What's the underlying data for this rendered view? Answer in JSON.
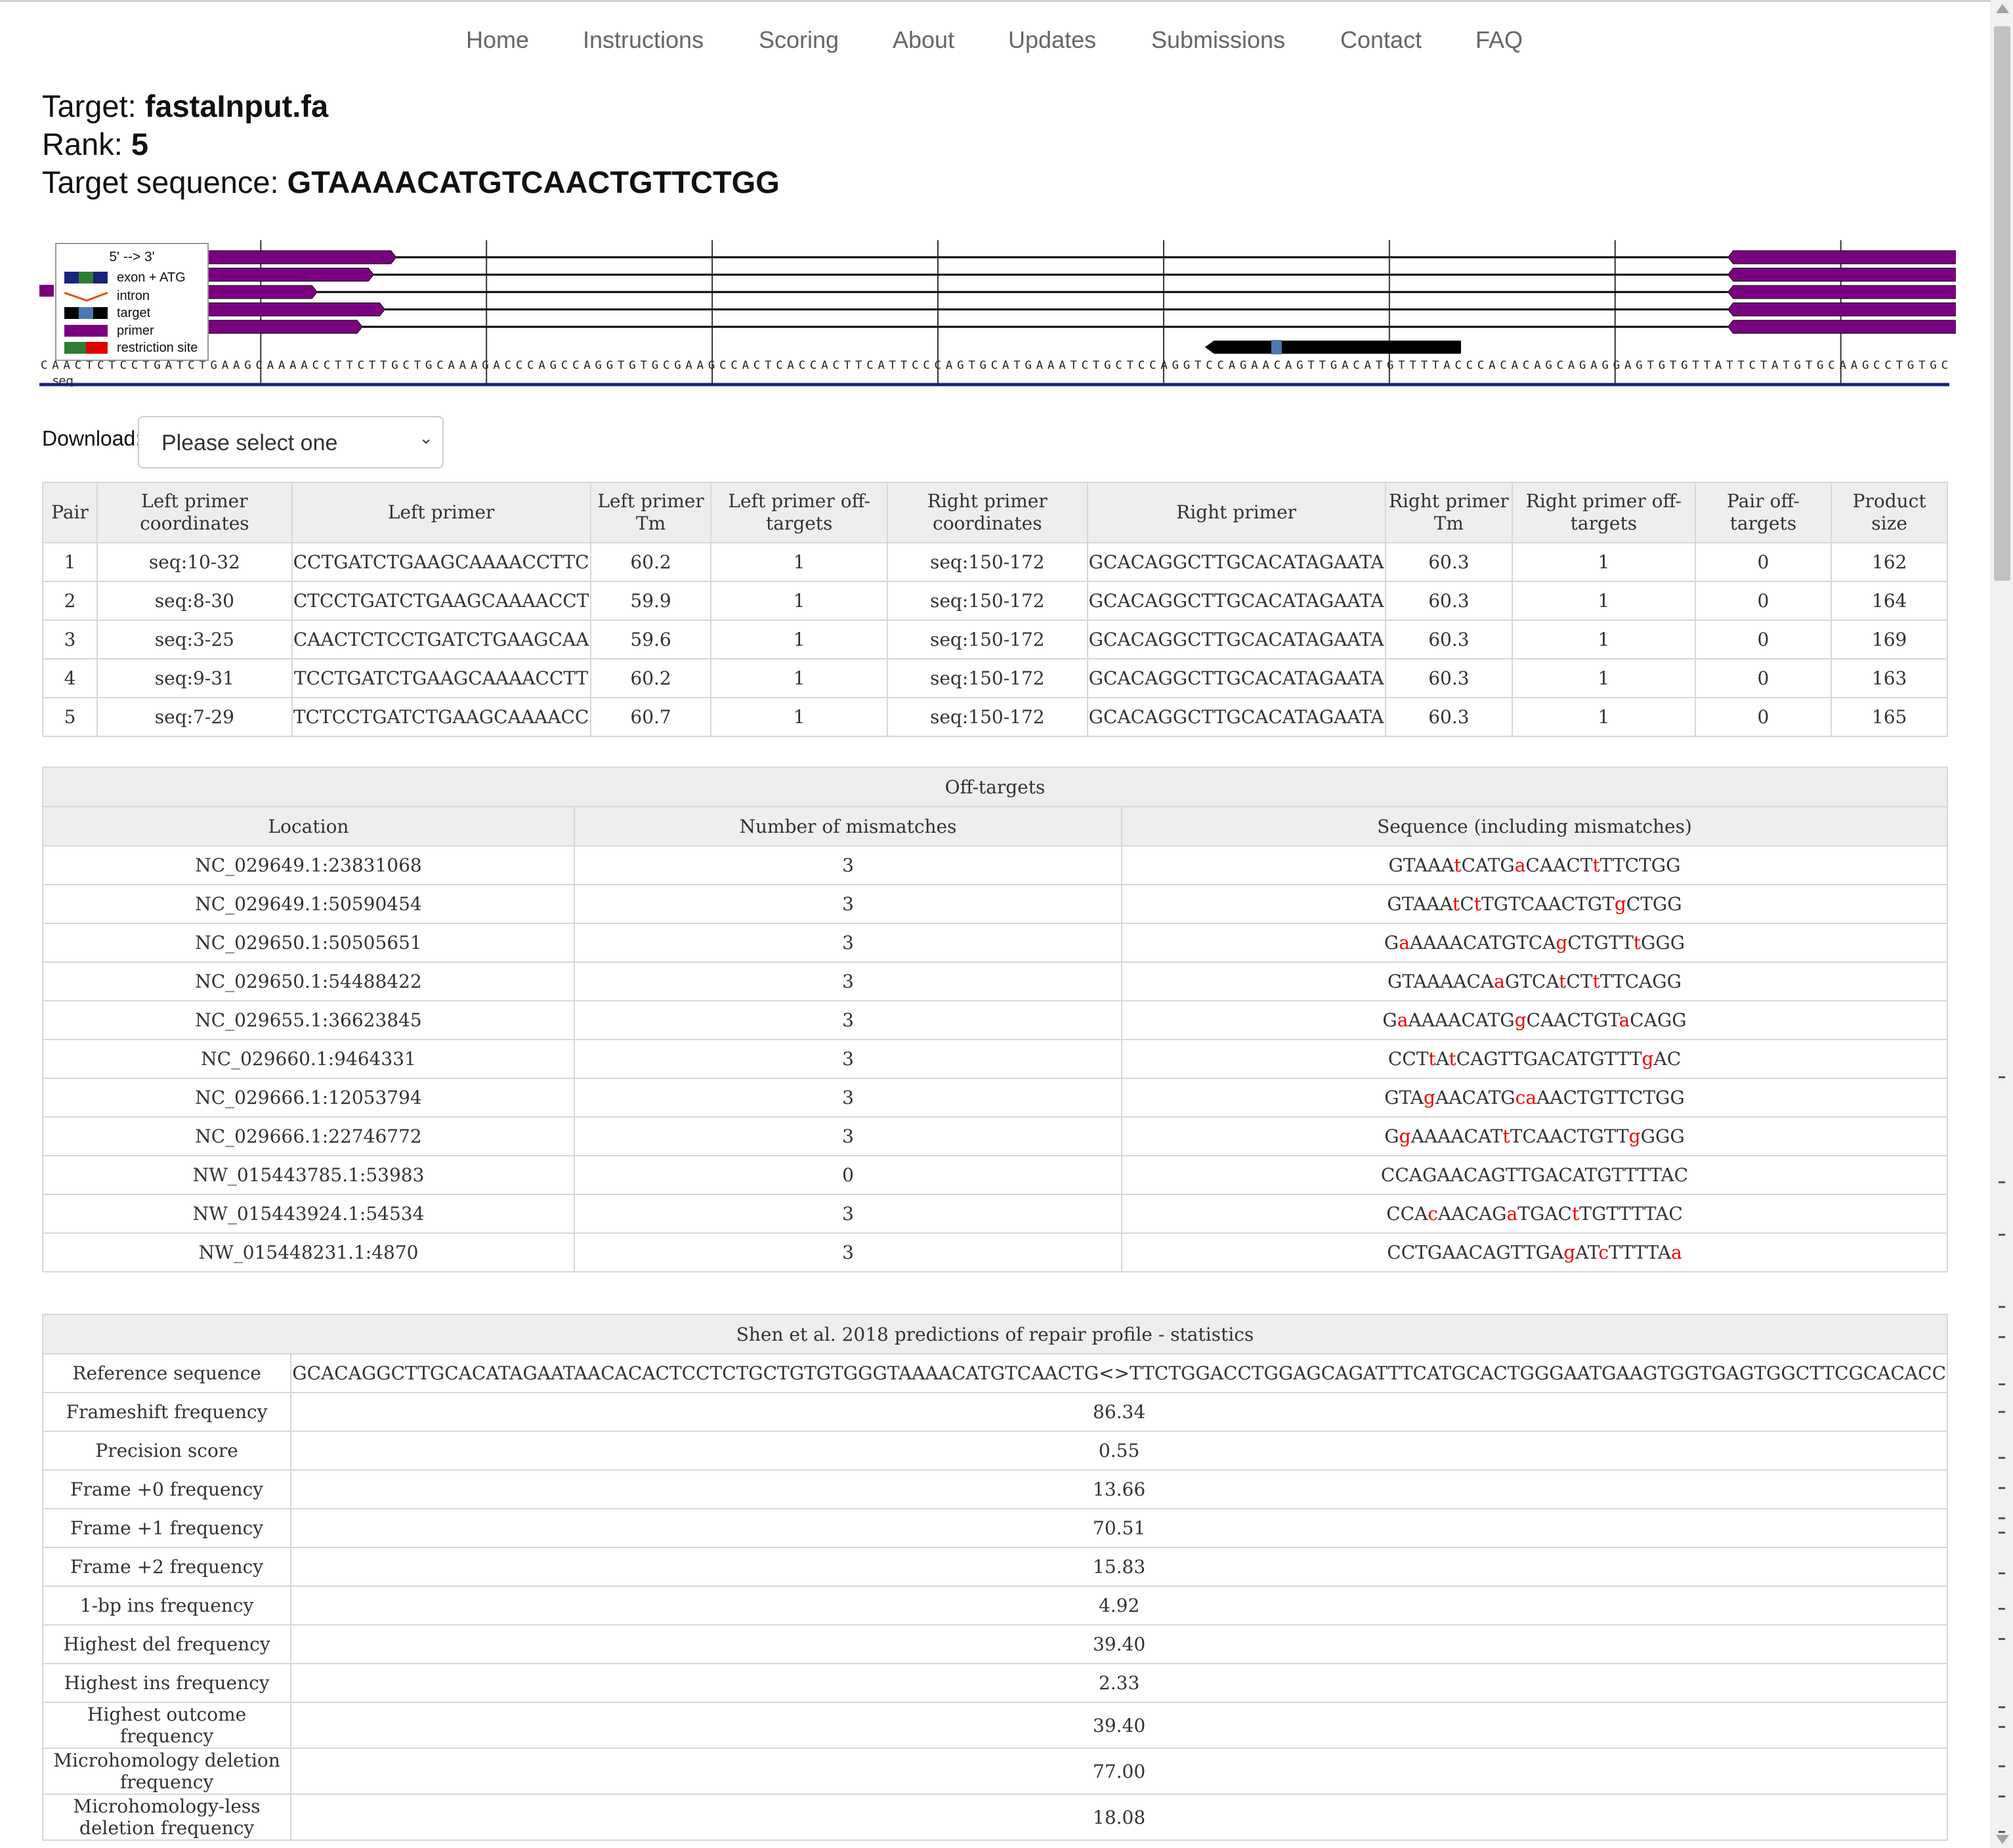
{
  "nav": [
    "Home",
    "Instructions",
    "Scoring",
    "About",
    "Updates",
    "Submissions",
    "Contact",
    "FAQ"
  ],
  "header": {
    "target_label": "Target: ",
    "target": "fastaInput.fa",
    "rank_label": "Rank: ",
    "rank": "5",
    "seq_label": "Target sequence: ",
    "seq": "GTAAAACATGTCAACTGTTCTGG"
  },
  "diagram": {
    "sequence": "CAACTCTCCTGATCTGAAGCAAAACCTTCTTGCTGCAAAGACCCAGCCAGGTGTGCGAAGCCACTCACCACTTCATTCCCAGTGCATGAAATCTGCTCCAGGTCCAGAACAGTTGACATGTTTTACCCACACAGCAGAGGAGTGTGTTATTCTATGTGCAAGCCTGTGC",
    "seq_name": "seq",
    "axis_ticks": [
      "20",
      "40",
      "60",
      "80",
      "100",
      "120",
      "140",
      "160"
    ],
    "legend": {
      "title": "5' --> 3'",
      "items": [
        "exon + ATG",
        "intron",
        "target",
        "primer",
        "restriction site"
      ]
    },
    "colors": {
      "primer": "#7a0080",
      "target": "#000000",
      "target_pam": "#4a7ab0",
      "axis": "#1a237e"
    }
  },
  "download": {
    "label": "Download:",
    "placeholder": "Please select one"
  },
  "pairs_table": {
    "headers": [
      "Pair",
      "Left primer coordinates",
      "Left primer",
      "Left primer Tm",
      "Left primer off-targets",
      "Right primer coordinates",
      "Right primer",
      "Right primer Tm",
      "Right primer off-targets",
      "Pair off-targets",
      "Product size"
    ],
    "rows": [
      [
        "1",
        "seq:10-32",
        "CCTGATCTGAAGCAAAACCTTC",
        "60.2",
        "1",
        "seq:150-172",
        "GCACAGGCTTGCACATAGAATA",
        "60.3",
        "1",
        "0",
        "162"
      ],
      [
        "2",
        "seq:8-30",
        "CTCCTGATCTGAAGCAAAACCT",
        "59.9",
        "1",
        "seq:150-172",
        "GCACAGGCTTGCACATAGAATA",
        "60.3",
        "1",
        "0",
        "164"
      ],
      [
        "3",
        "seq:3-25",
        "CAACTCTCCTGATCTGAAGCAA",
        "59.6",
        "1",
        "seq:150-172",
        "GCACAGGCTTGCACATAGAATA",
        "60.3",
        "1",
        "0",
        "169"
      ],
      [
        "4",
        "seq:9-31",
        "TCCTGATCTGAAGCAAAACCTT",
        "60.2",
        "1",
        "seq:150-172",
        "GCACAGGCTTGCACATAGAATA",
        "60.3",
        "1",
        "0",
        "163"
      ],
      [
        "5",
        "seq:7-29",
        "TCTCCTGATCTGAAGCAAAACC",
        "60.7",
        "1",
        "seq:150-172",
        "GCACAGGCTTGCACATAGAATA",
        "60.3",
        "1",
        "0",
        "165"
      ]
    ]
  },
  "offtargets": {
    "title": "Off-targets",
    "headers": [
      "Location",
      "Number of mismatches",
      "Sequence (including mismatches)"
    ],
    "rows": [
      {
        "loc": "NC_029649.1:23831068",
        "mm": "3",
        "seq": "GTAAAtCATGaCAACTtTTCTGG"
      },
      {
        "loc": "NC_029649.1:50590454",
        "mm": "3",
        "seq": "GTAAAtCtTGTCAACTGTgCTGG"
      },
      {
        "loc": "NC_029650.1:50505651",
        "mm": "3",
        "seq": "GaAAAACATGTCAgCTGTTtGGG"
      },
      {
        "loc": "NC_029650.1:54488422",
        "mm": "3",
        "seq": "GTAAAACAaGTCAtCTtTTCAGG"
      },
      {
        "loc": "NC_029655.1:36623845",
        "mm": "3",
        "seq": "GaAAAACATGgCAACTGTaCAGG"
      },
      {
        "loc": "NC_029660.1:9464331",
        "mm": "3",
        "seq": "CCTtAtCAGTTGACATGTTTgAC"
      },
      {
        "loc": "NC_029666.1:12053794",
        "mm": "3",
        "seq": "GTAgAACATGcaAACTGTTCTGG"
      },
      {
        "loc": "NC_029666.1:22746772",
        "mm": "3",
        "seq": "GgAAAACATtTCAACTGTTgGGG"
      },
      {
        "loc": "NW_015443785.1:53983",
        "mm": "0",
        "seq": "CCAGAACAGTTGACATGTTTTAC"
      },
      {
        "loc": "NW_015443924.1:54534",
        "mm": "3",
        "seq": "CCAcAACAGaTGACtTGTTTTAC"
      },
      {
        "loc": "NW_015448231.1:4870",
        "mm": "3",
        "seq": "CCTGAACAGTTGAgATcTTTTAa"
      }
    ]
  },
  "shen": {
    "title": "Shen et al. 2018 predictions of repair profile - statistics",
    "rows": [
      [
        "Reference sequence",
        "GCACAGGCTTGCACATAGAATAACACACTCCTCTGCTGTGTGGGTAAAACATGTCAACTG<>TTCTGGACCTGGAGCAGATTTCATGCACTGGGAATGAAGTGGTGAGTGGCTTCGCACACC"
      ],
      [
        "Frameshift frequency",
        "86.34"
      ],
      [
        "Precision score",
        "0.55"
      ],
      [
        "Frame +0 frequency",
        "13.66"
      ],
      [
        "Frame +1 frequency",
        "70.51"
      ],
      [
        "Frame +2 frequency",
        "15.83"
      ],
      [
        "1-bp ins frequency",
        "4.92"
      ],
      [
        "Highest del frequency",
        "39.40"
      ],
      [
        "Highest ins frequency",
        "2.33"
      ],
      [
        "Highest outcome frequency",
        "39.40"
      ],
      [
        "Microhomology deletion frequency",
        "77.00"
      ],
      [
        "Microhomology-less deletion frequency",
        "18.08"
      ]
    ]
  }
}
